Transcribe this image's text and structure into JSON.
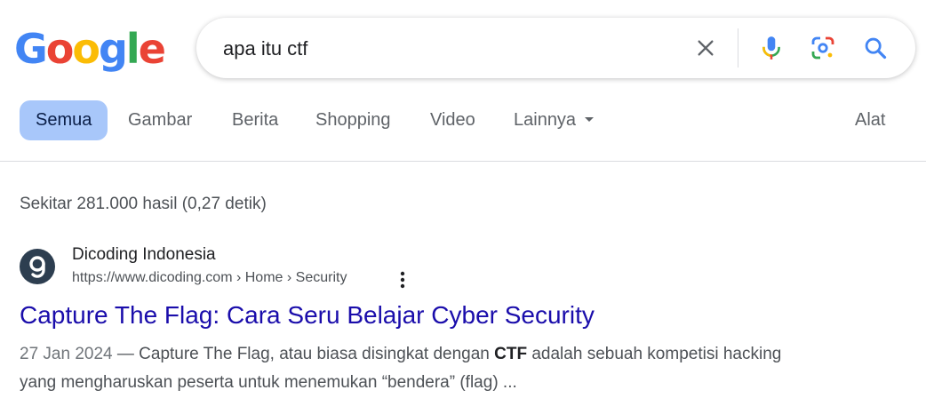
{
  "logo": {
    "letters": [
      {
        "char": "G",
        "color": "#4285F4"
      },
      {
        "char": "o",
        "color": "#EA4335"
      },
      {
        "char": "o",
        "color": "#FBBC05"
      },
      {
        "char": "g",
        "color": "#4285F4"
      },
      {
        "char": "l",
        "color": "#34A853"
      },
      {
        "char": "e",
        "color": "#EA4335"
      }
    ]
  },
  "search": {
    "query": "apa itu ctf",
    "icons": {
      "clear": "close-icon",
      "voice": "microphone-icon",
      "lens": "camera-lens-icon",
      "submit": "search-icon"
    }
  },
  "tabs": {
    "all": "Semua",
    "images": "Gambar",
    "news": "Berita",
    "shopping": "Shopping",
    "video": "Video",
    "more": "Lainnya",
    "tools": "Alat"
  },
  "stats": "Sekitar 281.000 hasil (0,27 detik)",
  "result": {
    "site_name": "Dicoding Indonesia",
    "url": "https://www.dicoding.com › Home › Security",
    "title": "Capture The Flag: Cara Seru Belajar Cyber Security",
    "date": "27 Jan 2024",
    "snippet_pre": " — Capture The Flag, atau biasa disingkat dengan ",
    "snippet_bold": "CTF",
    "snippet_post": " adalah sebuah kompetisi hacking yang mengharuskan peserta untuk menemukan “bendera” (flag) ...",
    "favicon_icon": "dicoding-logo-icon",
    "menu_icon": "more-vert-icon"
  },
  "colors": {
    "link": "#1a0dab",
    "active_tab": "#a8c7fa"
  }
}
